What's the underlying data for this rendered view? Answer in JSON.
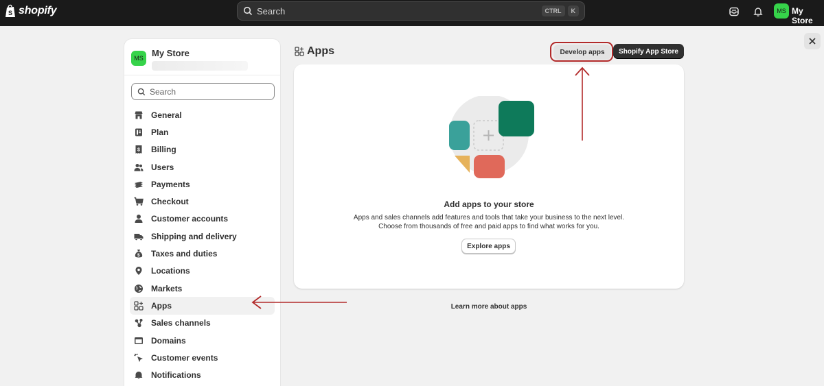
{
  "topbar": {
    "logo_text": "shopify",
    "search_placeholder": "Search",
    "shortcut_key1": "CTRL",
    "shortcut_key2": "K",
    "avatar_initials": "MS",
    "store_name": "My Store"
  },
  "sidebar": {
    "store_name": "My Store",
    "avatar_initials": "MS",
    "search_placeholder": "Search",
    "items": [
      {
        "label": "General",
        "icon": "store-icon"
      },
      {
        "label": "Plan",
        "icon": "plan-icon"
      },
      {
        "label": "Billing",
        "icon": "receipt-icon"
      },
      {
        "label": "Users",
        "icon": "users-icon"
      },
      {
        "label": "Payments",
        "icon": "payments-icon"
      },
      {
        "label": "Checkout",
        "icon": "cart-icon"
      },
      {
        "label": "Customer accounts",
        "icon": "person-icon"
      },
      {
        "label": "Shipping and delivery",
        "icon": "truck-icon"
      },
      {
        "label": "Taxes and duties",
        "icon": "money-bag-icon"
      },
      {
        "label": "Locations",
        "icon": "location-pin-icon"
      },
      {
        "label": "Markets",
        "icon": "globe-icon"
      },
      {
        "label": "Apps",
        "icon": "apps-icon",
        "active": true
      },
      {
        "label": "Sales channels",
        "icon": "sales-channels-icon"
      },
      {
        "label": "Domains",
        "icon": "domain-icon"
      },
      {
        "label": "Customer events",
        "icon": "cursor-click-icon"
      },
      {
        "label": "Notifications",
        "icon": "bell-icon"
      }
    ]
  },
  "main": {
    "title": "Apps",
    "develop_apps_label": "Develop apps",
    "app_store_label": "Shopify App Store",
    "card": {
      "title": "Add apps to your store",
      "desc_line1": "Apps and sales channels add features and tools that take your business to the next level.",
      "desc_line2": "Choose from thousands of free and paid apps to find what works for you.",
      "explore_label": "Explore apps"
    },
    "learn_more": "Learn more about apps"
  },
  "colors": {
    "topbar_bg": "#1a1a1a",
    "avatar_green": "#36d34a",
    "annotation_red": "#b22a2a",
    "page_bg": "#f1f1f1"
  }
}
